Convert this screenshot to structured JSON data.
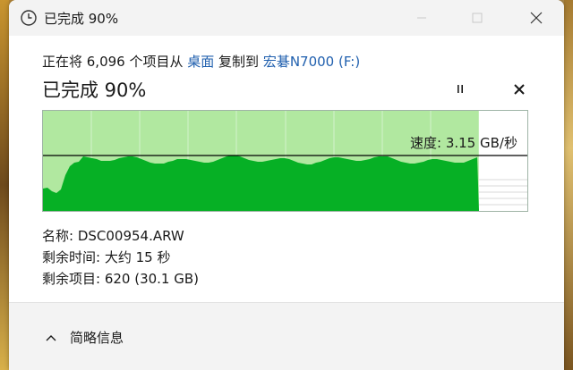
{
  "window": {
    "title": "已完成 90%"
  },
  "header": {
    "prefix": "正在将 6,096 个项目从 ",
    "source": "桌面",
    "middle": " 复制到 ",
    "destination": "宏碁N7000 (F:)"
  },
  "status": {
    "title": "已完成 90%",
    "progress_percent": 90
  },
  "graph": {
    "speed_label": "速度: 3.15 GB/秒",
    "colors": {
      "completed_bg": "#b1e8a0",
      "fill": "#06b025",
      "line": "#000000"
    }
  },
  "details": {
    "name_label": "名称: ",
    "name_value": "DSC00954.ARW",
    "time_label": "剩余时间: ",
    "time_value": "大约 15 秒",
    "items_label": "剩余项目: ",
    "items_value": "620 (30.1 GB)"
  },
  "footer": {
    "less_details_label": "简略信息"
  },
  "icons": {
    "title": "clock-icon",
    "minimize": "minimize-icon",
    "maximize": "maximize-icon",
    "close": "close-icon",
    "pause": "pause-icon",
    "cancel": "cancel-icon",
    "collapse": "chevron-up-icon"
  }
}
